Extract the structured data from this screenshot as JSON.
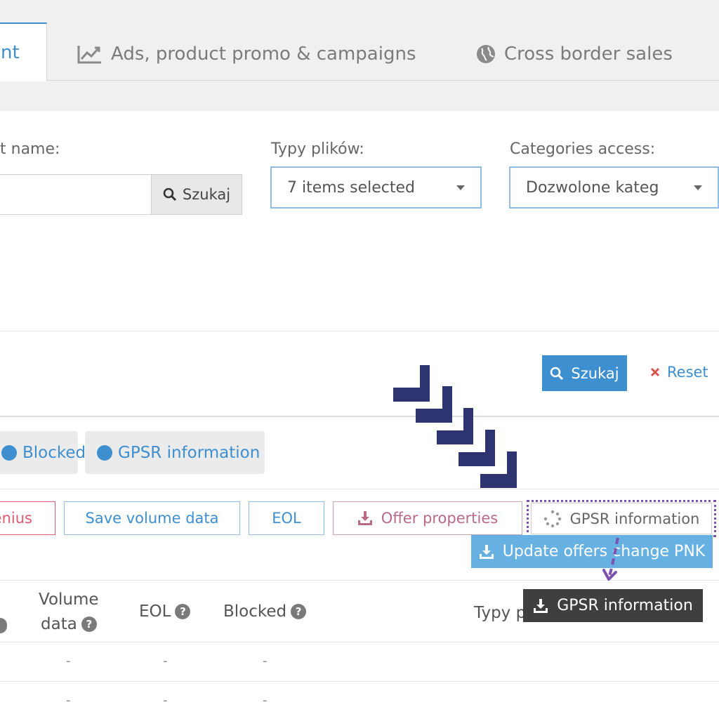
{
  "tabs": {
    "active_label": "nt",
    "ads_label": "Ads, product promo & campaigns",
    "cross_border_label": "Cross border sales"
  },
  "filters": {
    "name_label": "t name:",
    "search_button": "Szukaj",
    "file_types_label": "Typy plików:",
    "file_types_value": "7 items selected",
    "categories_label": "Categories access:",
    "categories_value": "Dozwolone kateg"
  },
  "actions": {
    "search_button": "Szukaj",
    "reset_label": "Reset"
  },
  "status_pills": {
    "blocked": "Blocked",
    "gpsr": "GPSR information"
  },
  "toolbar": {
    "genius": "enius",
    "save_volume": "Save volume data",
    "eol": "EOL",
    "offer_properties": "Offer properties",
    "gpsr_information": "GPSR information",
    "update_offers": "Update offers change PNK",
    "gpsr_download": "GPSR information"
  },
  "table": {
    "headers": {
      "volume_line1": "Volume",
      "volume_line2": "data",
      "eol": "EOL",
      "blocked": "Blocked",
      "typy": "Typy p"
    },
    "rows": [
      [
        "-",
        "-",
        "-"
      ],
      [
        "-",
        "-",
        "-"
      ]
    ]
  },
  "colors": {
    "accent": "#3d8fd0",
    "danger": "#e05a6d",
    "overlay_dark": "#3f3f3f",
    "annotation_purple": "#7b52b0",
    "chevron_navy": "#2d3470"
  }
}
